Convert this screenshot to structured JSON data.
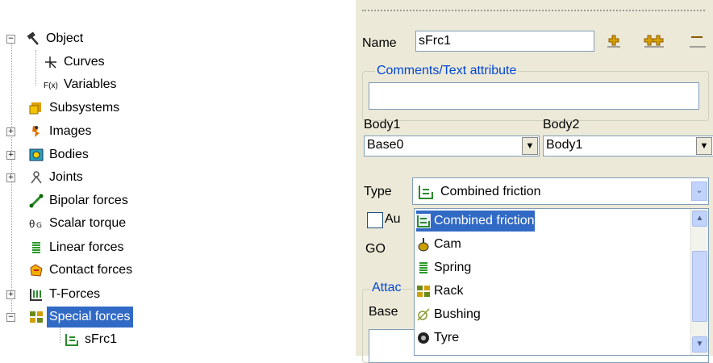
{
  "tree": {
    "items": [
      {
        "label": "Object",
        "icon": "hammer-icon",
        "expander": "−"
      },
      {
        "label": "Curves",
        "icon": "curves-icon"
      },
      {
        "label": "Variables",
        "icon": "variables-icon",
        "prefix": "F(x)"
      },
      {
        "label": "Subsystems",
        "icon": "subsystems-icon"
      },
      {
        "label": "Images",
        "icon": "images-icon",
        "expander": "+"
      },
      {
        "label": "Bodies",
        "icon": "bodies-icon",
        "expander": "+"
      },
      {
        "label": "Joints",
        "icon": "joints-icon",
        "expander": "+"
      },
      {
        "label": "Bipolar forces",
        "icon": "bipolar-forces-icon"
      },
      {
        "label": "Scalar torque",
        "icon": "scalar-torque-icon"
      },
      {
        "label": "Linear forces",
        "icon": "linear-forces-icon"
      },
      {
        "label": "Contact forces",
        "icon": "contact-forces-icon"
      },
      {
        "label": "T-Forces",
        "icon": "t-forces-icon",
        "expander": "+"
      },
      {
        "label": "Special forces",
        "icon": "special-forces-icon",
        "expander": "−",
        "selected": true
      },
      {
        "label": "sFrc1",
        "icon": "sfrc-icon"
      }
    ]
  },
  "panel": {
    "name_label": "Name",
    "name_value": "sFrc1",
    "comments_legend": "Comments/Text attribute",
    "comments_value": "",
    "body1_label": "Body1",
    "body2_label": "Body2",
    "body1_value": "Base0",
    "body2_value": "Body1",
    "type_label": "Type",
    "type_value": "Combined friction",
    "checkbox_label": "Au",
    "go_label": "GO",
    "attach_legend": "Attac",
    "base_label": "Base"
  },
  "dropdown": {
    "options": [
      {
        "label": "Combined friction",
        "icon": "combined-friction-icon",
        "selected": true
      },
      {
        "label": "Cam",
        "icon": "cam-icon"
      },
      {
        "label": "Spring",
        "icon": "spring-icon"
      },
      {
        "label": "Rack",
        "icon": "rack-icon"
      },
      {
        "label": "Bushing",
        "icon": "bushing-icon"
      },
      {
        "label": "Tyre",
        "icon": "tyre-icon"
      }
    ]
  },
  "colors": {
    "selection": "#316ac5",
    "panel_bg": "#ece9d8",
    "legend": "#0046d5"
  }
}
